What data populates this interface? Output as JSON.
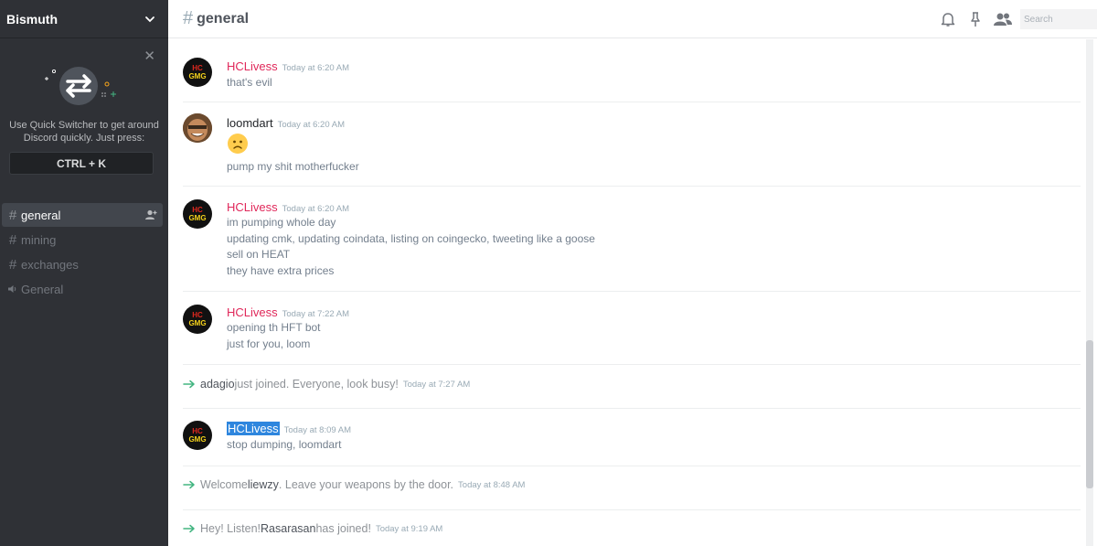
{
  "server": {
    "name": "Bismuth"
  },
  "quick_switcher": {
    "text_line1": "Use Quick Switcher to get around",
    "text_line2": "Discord quickly. Just press:",
    "shortcut": "CTRL + K"
  },
  "channels": [
    {
      "name": "general",
      "type": "text",
      "active": true
    },
    {
      "name": "mining",
      "type": "text",
      "active": false
    },
    {
      "name": "exchanges",
      "type": "text",
      "active": false
    },
    {
      "name": "General",
      "type": "voice",
      "active": false
    }
  ],
  "header": {
    "hash": "#",
    "channel": "general",
    "search_placeholder": "Search",
    "icons": [
      "bell-icon",
      "pin-icon",
      "members-icon"
    ]
  },
  "avatar_text": {
    "top": "HC",
    "bottom": "GMG"
  },
  "messages": [
    {
      "author": "HCLivess",
      "time": "Today at 6:20 AM",
      "lines": [
        "that's evil"
      ]
    },
    {
      "author": "loomdart",
      "time": "Today at 6:20 AM",
      "emoji": "frowning-face",
      "lines": [
        "pump my shit motherfucker"
      ]
    },
    {
      "author": "HCLivess",
      "time": "Today at 6:20 AM",
      "lines": [
        "im pumping whole day",
        "updating cmk, updating coindata, listing on coingecko, tweeting like a goose",
        "sell on HEAT",
        "they have extra prices"
      ]
    },
    {
      "author": "HCLivess",
      "time": "Today at 7:22 AM",
      "lines": [
        "opening th HFT bot",
        "just for you, loom"
      ]
    },
    {
      "author": "HCLivess",
      "time": "Today at 8:09 AM",
      "lines": [
        "stop dumping, loomdart"
      ]
    }
  ],
  "system_messages": [
    {
      "pre": "",
      "user": "adagio",
      "post": " just joined. Everyone, look busy!",
      "time": "Today at 7:27 AM"
    },
    {
      "pre": "Welcome ",
      "user": "liewzy",
      "post": ". Leave your weapons by the door.",
      "time": "Today at 8:48 AM"
    },
    {
      "pre": "Hey! Listen! ",
      "user": "Rasarasan",
      "post": " has joined!",
      "time": "Today at 9:19 AM"
    }
  ],
  "colors": {
    "sidebar": "#2f3136",
    "author_red": "#e0285a",
    "join_arrow": "#43b581",
    "highlight": "#2e86de"
  }
}
